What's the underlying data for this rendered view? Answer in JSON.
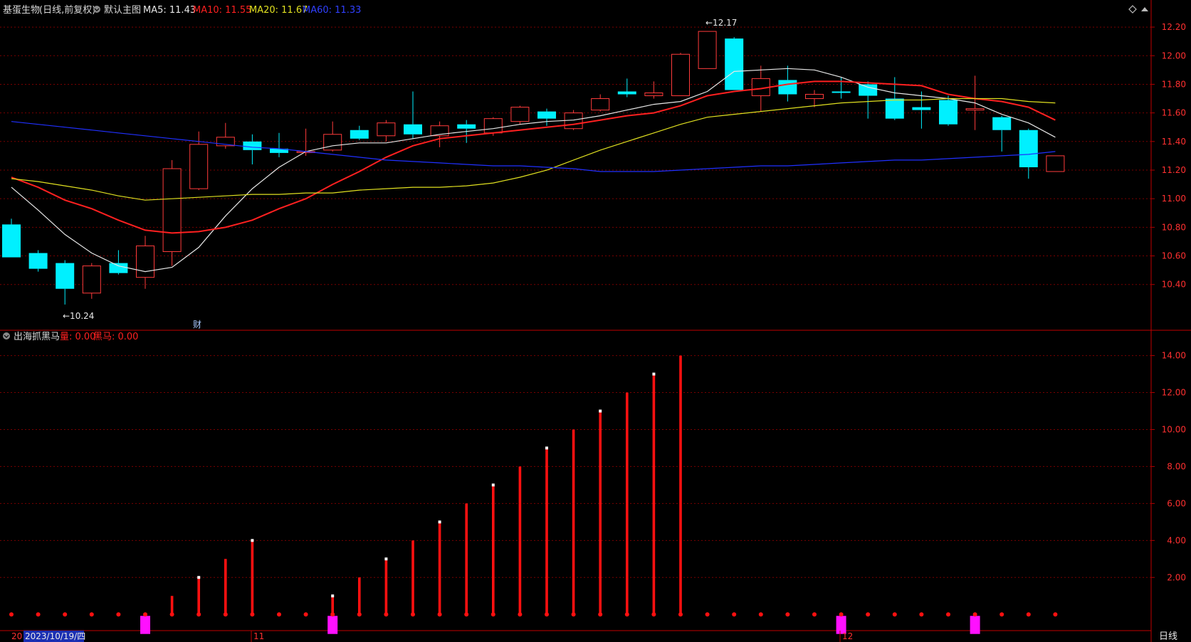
{
  "colors": {
    "background": "#000000",
    "frame": "#b00000",
    "grid": "#7a0000",
    "up": "#ff3b3b",
    "down": "#00f0ff",
    "ma5": "#e8e8e8",
    "ma10": "#ff2020",
    "ma20": "#e0e020",
    "ma60": "#2030ff",
    "volume_bar": "#ff1010",
    "black_horse": "#ff10ff"
  },
  "header": {
    "stock_name": "基蛋生物",
    "period_adjust": "(日线,前复权)",
    "main_chart_label": "默认主图",
    "ma5_label": "MA5: 11.43",
    "ma10_label": "MA10: 11.55",
    "ma20_label": "MA20: 11.67",
    "ma60_label": "MA60: 11.33"
  },
  "sub_header": {
    "indicator_name": "出海抓黑马",
    "liang_label": "量: 0.00",
    "heima_label": "黑马: 0.00"
  },
  "annotations": {
    "low": "←10.24",
    "high": "←12.17",
    "cai": "财"
  },
  "time_axis": {
    "left_clip": "20",
    "cursor_date": "2023/10/19/四",
    "month_11": "11",
    "month_12": "12",
    "period_button": "日线"
  },
  "chart_data": [
    {
      "type": "candlestick",
      "title": "基蛋生物 (日线,前复权)",
      "ylim": [
        10.1,
        12.28
      ],
      "y_ticks": [
        "12.20",
        "12.00",
        "11.80",
        "11.60",
        "11.40",
        "11.20",
        "11.00",
        "10.80",
        "10.60",
        "10.40"
      ],
      "candles": [
        {
          "o": 10.82,
          "c": 10.59,
          "h": 10.86,
          "l": 10.59
        },
        {
          "o": 10.62,
          "c": 10.51,
          "h": 10.64,
          "l": 10.49
        },
        {
          "o": 10.55,
          "c": 10.37,
          "h": 10.57,
          "l": 10.26
        },
        {
          "o": 10.34,
          "c": 10.53,
          "h": 10.55,
          "l": 10.3
        },
        {
          "o": 10.55,
          "c": 10.48,
          "h": 10.64,
          "l": 10.47
        },
        {
          "o": 10.45,
          "c": 10.67,
          "h": 10.74,
          "l": 10.37
        },
        {
          "o": 10.63,
          "c": 11.21,
          "h": 11.27,
          "l": 10.53
        },
        {
          "o": 11.07,
          "c": 11.38,
          "h": 11.47,
          "l": 11.06
        },
        {
          "o": 11.37,
          "c": 11.43,
          "h": 11.53,
          "l": 11.35
        },
        {
          "o": 11.4,
          "c": 11.34,
          "h": 11.45,
          "l": 11.24
        },
        {
          "o": 11.35,
          "c": 11.32,
          "h": 11.46,
          "l": 11.29
        },
        {
          "o": 11.33,
          "c": 11.33,
          "h": 11.49,
          "l": 11.3
        },
        {
          "o": 11.34,
          "c": 11.45,
          "h": 11.54,
          "l": 11.33
        },
        {
          "o": 11.48,
          "c": 11.42,
          "h": 11.51,
          "l": 11.41
        },
        {
          "o": 11.44,
          "c": 11.53,
          "h": 11.55,
          "l": 11.4
        },
        {
          "o": 11.52,
          "c": 11.45,
          "h": 11.75,
          "l": 11.42
        },
        {
          "o": 11.44,
          "c": 11.51,
          "h": 11.54,
          "l": 11.36
        },
        {
          "o": 11.52,
          "c": 11.49,
          "h": 11.55,
          "l": 11.39
        },
        {
          "o": 11.46,
          "c": 11.56,
          "h": 11.57,
          "l": 11.44
        },
        {
          "o": 11.54,
          "c": 11.64,
          "h": 11.65,
          "l": 11.52
        },
        {
          "o": 11.61,
          "c": 11.56,
          "h": 11.63,
          "l": 11.51
        },
        {
          "o": 11.49,
          "c": 11.6,
          "h": 11.62,
          "l": 11.48
        },
        {
          "o": 11.62,
          "c": 11.7,
          "h": 11.73,
          "l": 11.61
        },
        {
          "o": 11.75,
          "c": 11.73,
          "h": 11.84,
          "l": 11.71
        },
        {
          "o": 11.72,
          "c": 11.74,
          "h": 11.82,
          "l": 11.7
        },
        {
          "o": 11.72,
          "c": 12.01,
          "h": 12.02,
          "l": 11.72
        },
        {
          "o": 11.91,
          "c": 12.17,
          "h": 12.17,
          "l": 11.91
        },
        {
          "o": 12.12,
          "c": 11.76,
          "h": 12.13,
          "l": 11.76
        },
        {
          "o": 11.72,
          "c": 11.84,
          "h": 11.93,
          "l": 11.61
        },
        {
          "o": 11.83,
          "c": 11.73,
          "h": 11.93,
          "l": 11.68
        },
        {
          "o": 11.7,
          "c": 11.73,
          "h": 11.76,
          "l": 11.64
        },
        {
          "o": 11.75,
          "c": 11.74,
          "h": 11.85,
          "l": 11.7
        },
        {
          "o": 11.8,
          "c": 11.72,
          "h": 11.82,
          "l": 11.56
        },
        {
          "o": 11.7,
          "c": 11.56,
          "h": 11.85,
          "l": 11.55
        },
        {
          "o": 11.64,
          "c": 11.62,
          "h": 11.75,
          "l": 11.49
        },
        {
          "o": 11.69,
          "c": 11.52,
          "h": 11.72,
          "l": 11.51
        },
        {
          "o": 11.62,
          "c": 11.63,
          "h": 11.86,
          "l": 11.48
        },
        {
          "o": 11.57,
          "c": 11.48,
          "h": 11.58,
          "l": 11.33
        },
        {
          "o": 11.48,
          "c": 11.22,
          "h": 11.49,
          "l": 11.14
        },
        {
          "o": 11.19,
          "c": 11.3,
          "h": 11.3,
          "l": 11.19
        }
      ],
      "ma_series": [
        {
          "name": "MA5",
          "color": "#e8e8e8",
          "start": 0,
          "values": [
            11.08,
            10.92,
            10.75,
            10.62,
            10.53,
            10.49,
            10.52,
            10.66,
            10.88,
            11.07,
            11.22,
            11.33,
            11.37,
            11.39,
            11.39,
            11.42,
            11.45,
            11.47,
            11.49,
            11.52,
            11.54,
            11.55,
            11.58,
            11.62,
            11.66,
            11.68,
            11.75,
            11.89,
            11.9,
            11.91,
            11.9,
            11.85,
            11.78,
            11.74,
            11.72,
            11.7,
            11.67,
            11.59,
            11.53,
            11.43
          ]
        },
        {
          "name": "MA10",
          "color": "#ff2020",
          "start": 0,
          "values": [
            11.15,
            11.08,
            10.99,
            10.93,
            10.85,
            10.78,
            10.76,
            10.77,
            10.8,
            10.85,
            10.93,
            11.0,
            11.1,
            11.19,
            11.29,
            11.37,
            11.42,
            11.44,
            11.46,
            11.48,
            11.5,
            11.52,
            11.55,
            11.58,
            11.6,
            11.65,
            11.72,
            11.75,
            11.77,
            11.8,
            11.82,
            11.82,
            11.81,
            11.8,
            11.79,
            11.73,
            11.7,
            11.68,
            11.64,
            11.55
          ]
        },
        {
          "name": "MA20",
          "color": "#e0e020",
          "start": 0,
          "values": [
            11.14,
            11.12,
            11.09,
            11.06,
            11.02,
            10.99,
            11.0,
            11.01,
            11.02,
            11.03,
            11.03,
            11.04,
            11.04,
            11.06,
            11.07,
            11.08,
            11.08,
            11.09,
            11.11,
            11.15,
            11.2,
            11.27,
            11.34,
            11.4,
            11.46,
            11.52,
            11.57,
            11.59,
            11.61,
            11.63,
            11.65,
            11.67,
            11.68,
            11.69,
            11.69,
            11.7,
            11.7,
            11.7,
            11.68,
            11.67
          ]
        },
        {
          "name": "MA60",
          "color": "#2030ff",
          "start": 0,
          "values": [
            11.54,
            11.52,
            11.5,
            11.48,
            11.46,
            11.44,
            11.42,
            11.4,
            11.38,
            11.36,
            11.35,
            11.33,
            11.31,
            11.29,
            11.27,
            11.26,
            11.25,
            11.24,
            11.23,
            11.23,
            11.22,
            11.21,
            11.19,
            11.19,
            11.19,
            11.2,
            11.21,
            11.22,
            11.23,
            11.23,
            11.24,
            11.25,
            11.26,
            11.27,
            11.27,
            11.28,
            11.29,
            11.3,
            11.31,
            11.33
          ]
        }
      ]
    },
    {
      "type": "bar",
      "title": "出海抓黑马",
      "ylim": [
        -0.8,
        14.6
      ],
      "y_ticks": [
        "14.00",
        "12.00",
        "10.00",
        "8.00",
        "6.00",
        "4.00",
        "2.00"
      ],
      "series": [
        {
          "name": "量",
          "values": [
            0,
            0,
            0,
            0,
            0,
            0,
            1,
            2,
            3,
            4,
            0,
            0,
            1,
            2,
            3,
            4,
            5,
            6,
            7,
            8,
            9,
            10,
            11,
            12,
            13,
            14,
            0,
            0,
            0,
            0,
            0,
            0,
            0,
            0,
            0,
            0,
            0,
            0,
            0,
            0
          ]
        }
      ],
      "white_caps": [
        7,
        9,
        12,
        14,
        16,
        18,
        20,
        22,
        24
      ],
      "black_horse_days": [
        5,
        12,
        31,
        36
      ]
    }
  ]
}
